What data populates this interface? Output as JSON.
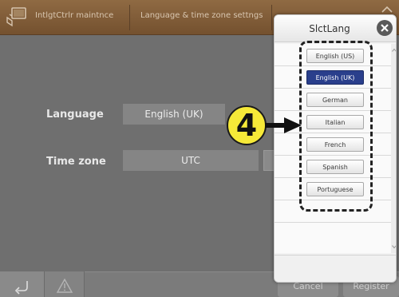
{
  "app": {
    "title": "IntlgtCtrlr maintnce",
    "screen_title": "Language & time zone settngs"
  },
  "settings": {
    "language_label": "Language",
    "language_value": "English (UK)",
    "timezone_label": "Time zone",
    "timezone_value": "UTC"
  },
  "bottom": {
    "cancel_label": "Cancel",
    "register_label": "Register"
  },
  "dialog": {
    "title": "SlctLang",
    "options": [
      {
        "label": "English (US)",
        "selected": false
      },
      {
        "label": "English (UK)",
        "selected": true
      },
      {
        "label": "German",
        "selected": false
      },
      {
        "label": "Italian",
        "selected": false
      },
      {
        "label": "French",
        "selected": false
      },
      {
        "label": "Spanish",
        "selected": false
      },
      {
        "label": "Portuguese",
        "selected": false
      }
    ]
  },
  "callout": {
    "step_number": "4",
    "fill_color": "#f6e938"
  },
  "colors": {
    "title_bar": "#7e5a37",
    "selected_option": "#2a3f8c",
    "background": "#6f6f6f"
  },
  "icons": {
    "app": "controller-icon",
    "back": "back-arrow-icon",
    "warning": "warning-icon",
    "close": "close-icon"
  }
}
